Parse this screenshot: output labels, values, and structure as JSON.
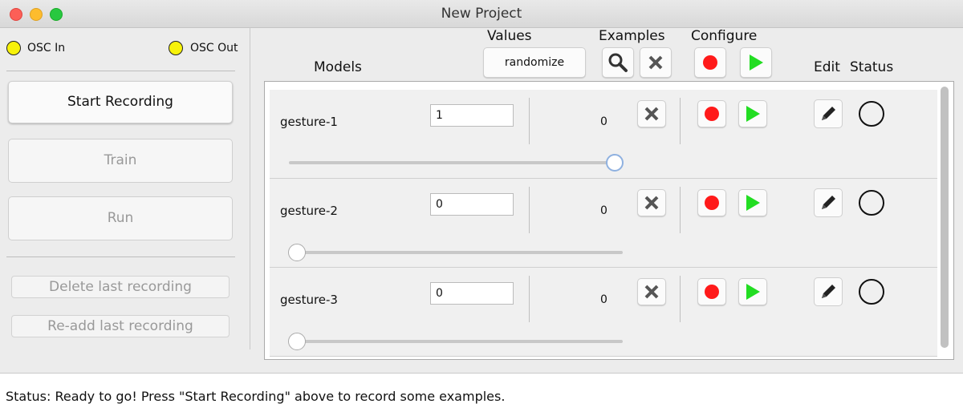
{
  "window": {
    "title": "New Project"
  },
  "sidebar": {
    "osc_in": "OSC In",
    "osc_out": "OSC Out",
    "start_recording": "Start Recording",
    "train": "Train",
    "run": "Run",
    "delete_last": "Delete last recording",
    "readd_last": "Re-add last recording"
  },
  "headers": {
    "models": "Models",
    "values": "Values",
    "examples": "Examples",
    "configure": "Configure",
    "edit": "Edit",
    "status": "Status"
  },
  "toolbar": {
    "randomize": "randomize"
  },
  "models": [
    {
      "name": "gesture-1",
      "value": "1",
      "examples": "0",
      "slider": 1.0
    },
    {
      "name": "gesture-2",
      "value": "0",
      "examples": "0",
      "slider": 0.0
    },
    {
      "name": "gesture-3",
      "value": "0",
      "examples": "0",
      "slider": 0.0
    }
  ],
  "colors": {
    "record": "#ff1a1a",
    "play": "#22dd22",
    "led": "#f7f20a"
  },
  "status_bar": {
    "text": "Status: Ready to go! Press \"Start Recording\" above to record some examples."
  }
}
